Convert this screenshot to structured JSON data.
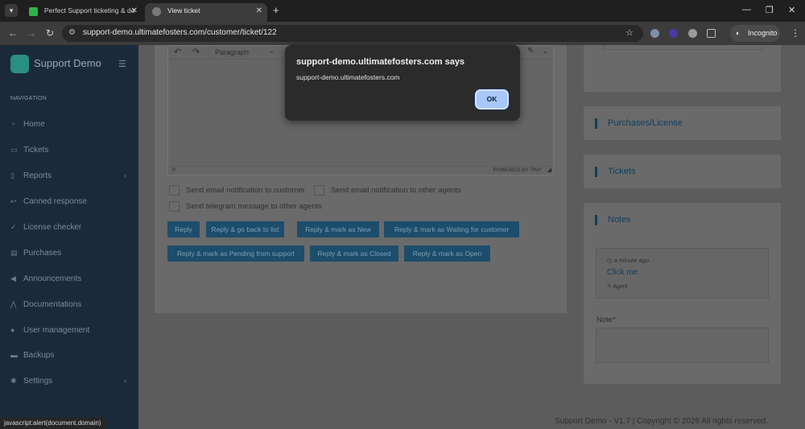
{
  "browser": {
    "tabs": [
      {
        "label": "Perfect Support ticketing & do",
        "active": false
      },
      {
        "label": "View ticket",
        "active": true
      }
    ],
    "url": "support-demo.ultimatefosters.com/customer/ticket/122",
    "incognito_label": "Incognito",
    "status_text": "javascript:alert(document.domain)"
  },
  "dialog": {
    "title": "support-demo.ultimatefosters.com says",
    "message": "support-demo.ultimatefosters.com",
    "ok_label": "OK"
  },
  "sidebar": {
    "brand": "Support Demo",
    "heading": "NAVIGATION",
    "items": [
      {
        "label": "Home",
        "icon": "speedometer-icon",
        "has_chevron": false
      },
      {
        "label": "Tickets",
        "icon": "ticket-icon",
        "has_chevron": false
      },
      {
        "label": "Reports",
        "icon": "file-icon",
        "has_chevron": true
      },
      {
        "label": "Canned response",
        "icon": "reply-icon",
        "has_chevron": false
      },
      {
        "label": "License checker",
        "icon": "check-circle-icon",
        "has_chevron": false
      },
      {
        "label": "Purchases",
        "icon": "cart-icon",
        "has_chevron": false
      },
      {
        "label": "Announcements",
        "icon": "megaphone-icon",
        "has_chevron": false
      },
      {
        "label": "Documentations",
        "icon": "chart-icon",
        "has_chevron": false
      },
      {
        "label": "User management",
        "icon": "users-icon",
        "has_chevron": false
      },
      {
        "label": "Backups",
        "icon": "database-icon",
        "has_chevron": false
      },
      {
        "label": "Settings",
        "icon": "gear-icon",
        "has_chevron": true
      }
    ]
  },
  "editor": {
    "block_format": "Paragraph",
    "path": "P",
    "branding": "POWERED BY TINY"
  },
  "options": {
    "email_customer": "Send email notification to customer",
    "email_agents": "Send email notification to other agents",
    "telegram": "Send telegram message to other agents"
  },
  "actions": {
    "reply": "Reply",
    "reply_back": "Reply & go back to list",
    "reply_new": "Reply & mark as New",
    "reply_waiting": "Reply & mark as Waiting for customer",
    "reply_pending": "Reply & mark as Pending from support",
    "reply_closed": "Reply & mark as Closed",
    "reply_open": "Reply & mark as Open"
  },
  "panels": {
    "purchases": "Purchases/License",
    "tickets": "Tickets",
    "notes": "Notes"
  },
  "note": {
    "time": "a minute ago",
    "link": "Click me",
    "author": "Agent",
    "input_label": "Note*"
  },
  "footer": "Support Demo - V1.7 | Copyright © 2026 All rights reserved."
}
